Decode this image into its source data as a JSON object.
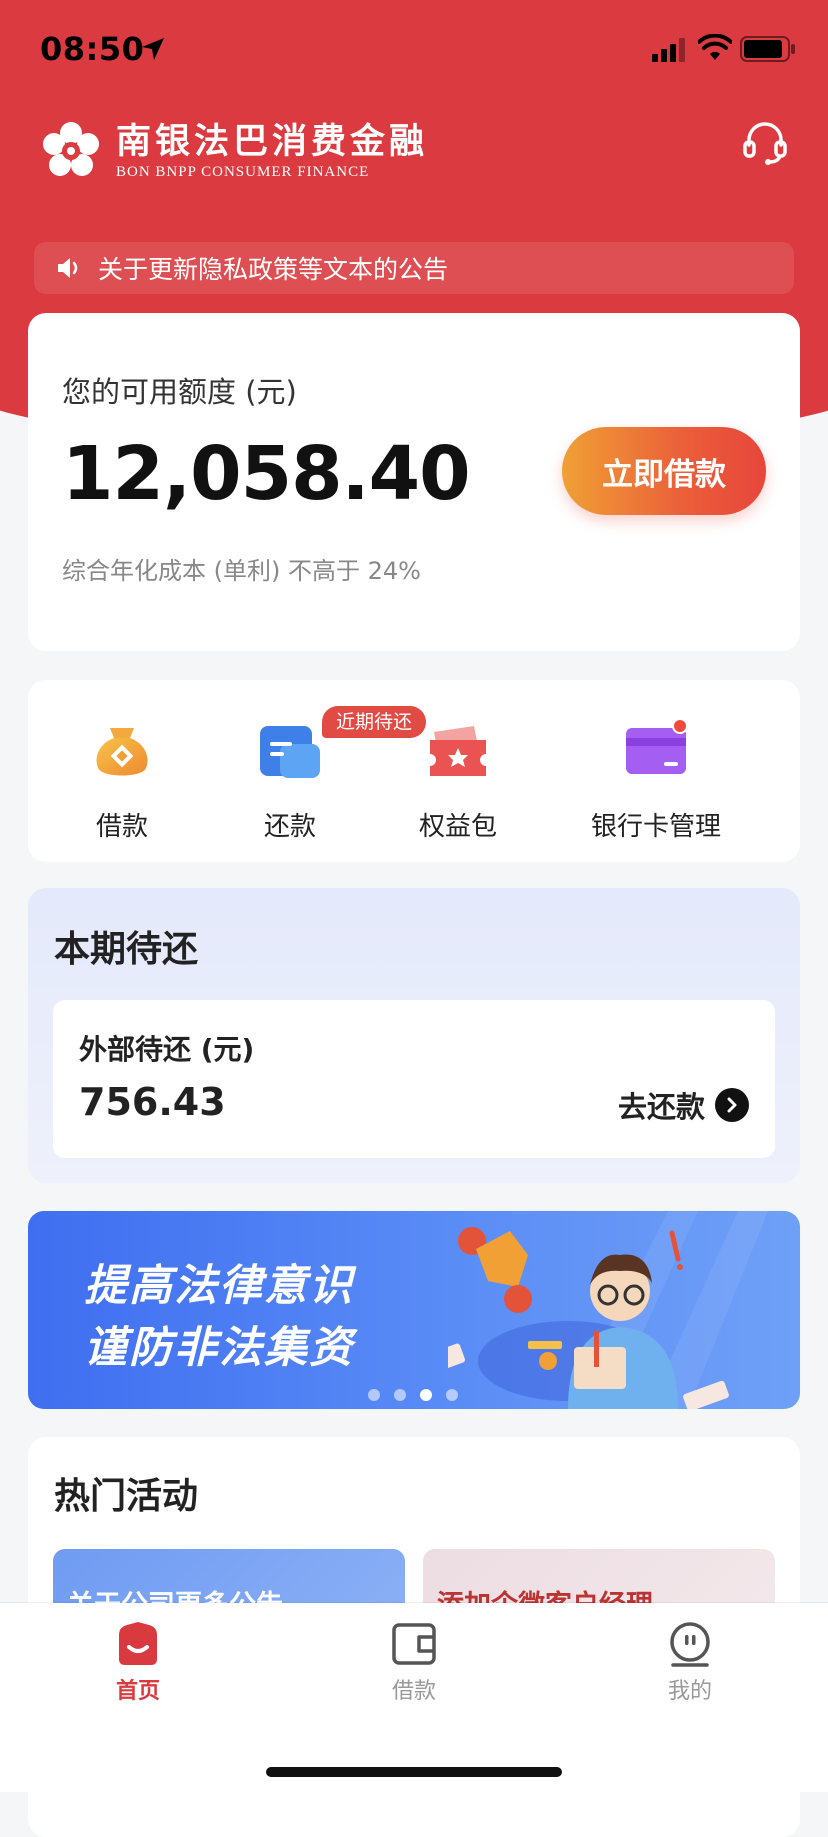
{
  "status_bar": {
    "time": "08:50"
  },
  "brand": {
    "name_cn": "南银法巴消费金融",
    "name_en": "BON BNPP CONSUMER FINANCE"
  },
  "notice": {
    "text": "关于更新隐私政策等文本的公告"
  },
  "credit": {
    "label": "您的可用额度 (元)",
    "amount": "12,058.40",
    "note": "综合年化成本 (单利) 不高于 24%",
    "cta": "立即借款"
  },
  "quick_actions": {
    "badge": "近期待还",
    "items": [
      {
        "label": "借款",
        "icon": "money-bag-icon"
      },
      {
        "label": "还款",
        "icon": "repay-icon"
      },
      {
        "label": "权益包",
        "icon": "benefits-ticket-icon"
      },
      {
        "label": "银行卡管理",
        "icon": "bank-card-icon"
      }
    ]
  },
  "due": {
    "title": "本期待还",
    "label": "外部待还 (元)",
    "amount": "756.43",
    "action": "去还款"
  },
  "banner": {
    "line1": "提高法律意识",
    "line2": "谨防非法集资",
    "slide_count": 4,
    "active_slide": 3
  },
  "activities": {
    "title": "热门活动",
    "tiles": [
      "关于公司更多公告",
      "添加企微客户经理"
    ]
  },
  "tabs": [
    {
      "label": "首页",
      "icon": "home-icon",
      "active": true
    },
    {
      "label": "借款",
      "icon": "wallet-icon",
      "active": false
    },
    {
      "label": "我的",
      "icon": "profile-icon",
      "active": false
    }
  ],
  "colors": {
    "brand_red": "#db3b40",
    "accent_orange": "#f0a035",
    "tab_active": "#d93a3f"
  }
}
